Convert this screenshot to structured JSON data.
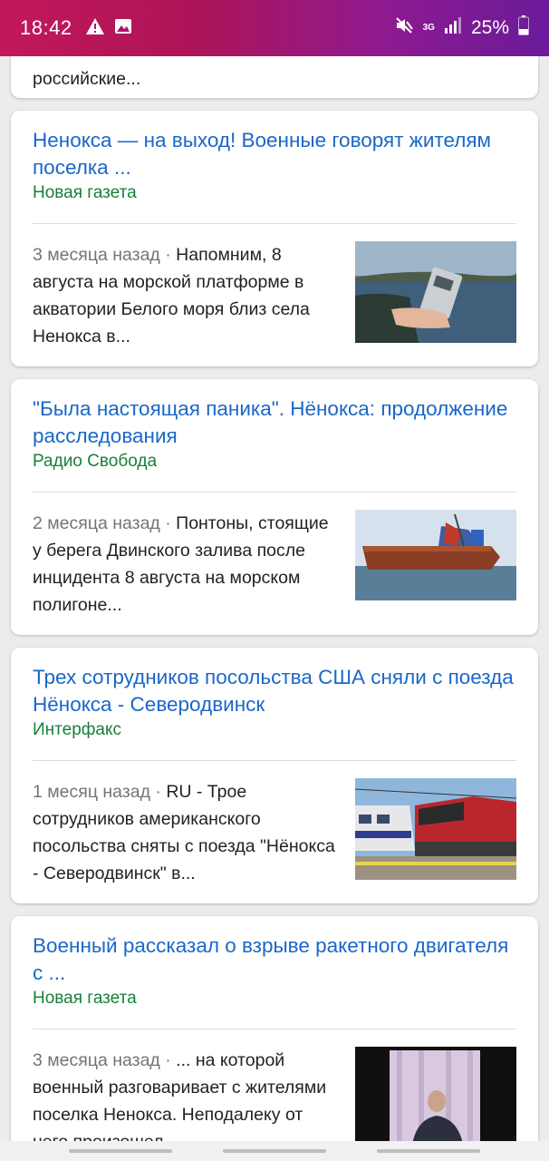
{
  "status_bar": {
    "time": "18:42",
    "battery": "25%",
    "network": "3G",
    "icons": [
      "warning-icon",
      "image-icon",
      "mute-icon",
      "signal-icon",
      "battery-icon"
    ]
  },
  "partial_card": {
    "snippet": "российские..."
  },
  "articles": [
    {
      "title": "Ненокса — на выход! Военные говорят жителям поселка ...",
      "source": "Новая газета",
      "time": "3 месяца назад",
      "separator": "·",
      "snippet": "Напомним, 8 августа на морской платформе в акватории Белого моря близ села Ненокса в...",
      "thumb": "sea-device-photo"
    },
    {
      "title": "\"Была настоящая паника\". Нёнокса: продолжение расследования",
      "source": "Радио Свобода",
      "time": "2 месяца назад",
      "separator": "·",
      "snippet": "Понтоны, стоящие у берега Двинского залива после инцидента 8 августа на морском полигоне...",
      "thumb": "pontoon-photo"
    },
    {
      "title": "Трех сотрудников посольства США сняли с поезда Нёнокса - Северодвинск",
      "source": "Интерфакс",
      "time": "1 месяц назад",
      "separator": "·",
      "snippet": "RU - Трое сотрудников американского посольства сняты с поезда \"Нёнокса - Северодвинск\" в...",
      "thumb": "train-photo"
    },
    {
      "title": "Военный рассказал о взрыве ракетного двигателя с ...",
      "source": "Новая газета",
      "time": "3 месяца назад",
      "separator": "·",
      "snippet": "... на которой военный разговаривает с жителями поселка Ненокса. Неподалеку от него произошел...",
      "thumb": "video-still-photo"
    }
  ],
  "colors": {
    "title": "#1a67c9",
    "source": "#188038",
    "time": "#70757a"
  }
}
